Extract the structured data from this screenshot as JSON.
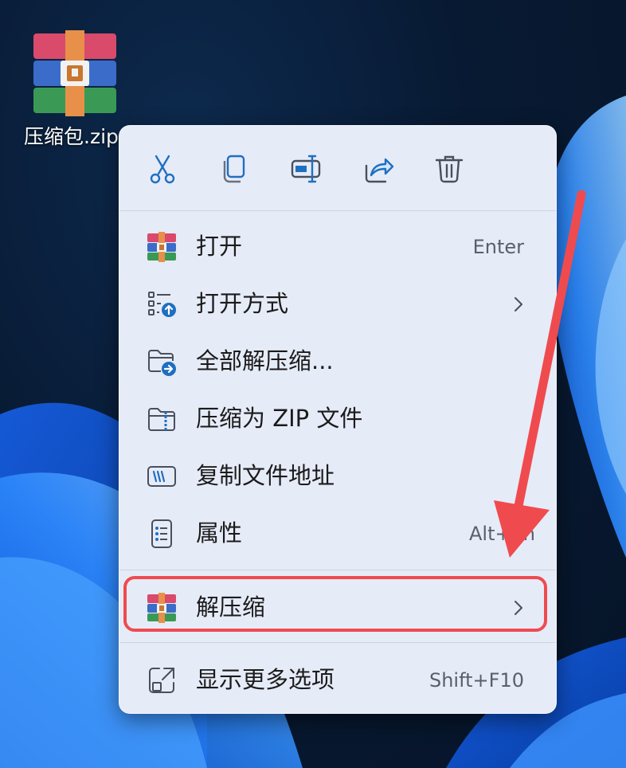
{
  "desktop": {
    "file_label": "压缩包.zip"
  },
  "quick_actions": [
    {
      "name": "cut",
      "icon": "scissors-icon"
    },
    {
      "name": "copy",
      "icon": "copy-icon"
    },
    {
      "name": "rename",
      "icon": "rename-icon"
    },
    {
      "name": "share",
      "icon": "share-icon"
    },
    {
      "name": "delete",
      "icon": "trash-icon"
    }
  ],
  "menu": {
    "items": [
      {
        "label": "打开",
        "shortcut": "Enter",
        "icon": "winrar-icon"
      },
      {
        "label": "打开方式",
        "icon": "open-with-icon",
        "submenu": true
      },
      {
        "label": "全部解压缩...",
        "icon": "extract-folder-icon"
      },
      {
        "label": "压缩为 ZIP 文件",
        "icon": "zip-folder-icon"
      },
      {
        "label": "复制文件地址",
        "icon": "copy-path-icon"
      },
      {
        "label": "属性",
        "shortcut": "Alt+En",
        "icon": "properties-icon"
      },
      {
        "label": "解压缩",
        "icon": "winrar-icon",
        "submenu": true,
        "highlighted": true
      },
      {
        "label": "显示更多选项",
        "shortcut": "Shift+F10",
        "icon": "show-more-icon"
      }
    ]
  },
  "colors": {
    "menu_bg": "#e6ebf8",
    "accent_blue": "#1f6fc0",
    "highlight_red": "#ef4b4f"
  }
}
